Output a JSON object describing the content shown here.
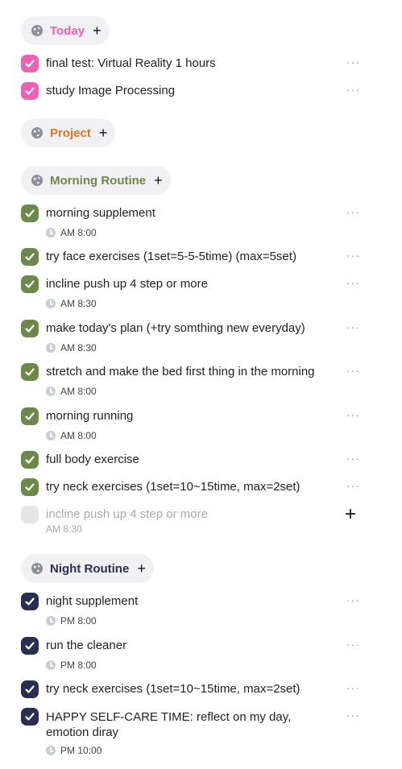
{
  "colors": {
    "today": "#ef5fb3",
    "project": "#e07328",
    "morning": "#6b8a4a",
    "night": "#2b2c52",
    "ghost": "#e6e6e6"
  },
  "sections": {
    "today": {
      "title": "Today",
      "tasks": [
        {
          "title": "final test: Virtual Reality 1 hours"
        },
        {
          "title": "study Image Processing"
        }
      ]
    },
    "project": {
      "title": "Project"
    },
    "morning": {
      "title": "Morning Routine",
      "tasks": [
        {
          "title": "morning supplement",
          "time": "AM 8:00"
        },
        {
          "title": "try face exercises (1set=5-5-5time) (max=5set)"
        },
        {
          "title": "incline push up 4 step or more",
          "time": "AM 8:30"
        },
        {
          "title": "make today's plan (+try somthing new everyday)",
          "time": "AM 8:30"
        },
        {
          "title": "stretch and make the bed first thing in the morning",
          "time": "AM 8:00"
        },
        {
          "title": "morning running",
          "time": "AM 8:00"
        },
        {
          "title": "full body exercise"
        },
        {
          "title": "try neck exercises (1set=10~15time, max=2set)"
        }
      ],
      "pending": {
        "title": "incline push up 4 step or more",
        "time": "AM 8:30"
      }
    },
    "night": {
      "title": "Night Routine",
      "tasks": [
        {
          "title": "night supplement",
          "time": "PM 8:00"
        },
        {
          "title": "run the cleaner",
          "time": "PM 8:00"
        },
        {
          "title": "try neck exercises (1set=10~15time, max=2set)"
        },
        {
          "title": "HAPPY SELF-CARE TIME: reflect on my day, emotion diray",
          "time": "PM 10:00"
        }
      ]
    }
  },
  "icons": {
    "globe": "globe-icon",
    "plus": "plus-icon",
    "more": "more-options-icon",
    "check": "check-icon",
    "clock": "clock-icon"
  }
}
